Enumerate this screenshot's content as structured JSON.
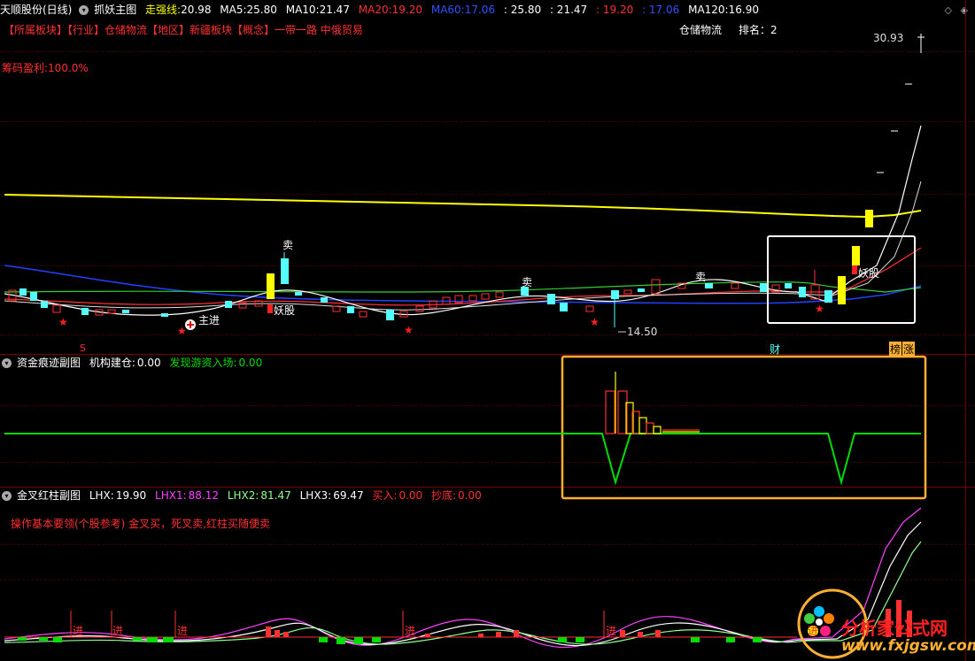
{
  "header": {
    "stock_name": "天顺股份(日线)",
    "indicator_name": "抓妖主图",
    "strong_line_label": "走强线:",
    "strong_line_value": "20.98",
    "ma5_label": "MA5:",
    "ma5_value": "25.80",
    "ma10_label": "MA10:",
    "ma10_value": "21.47",
    "ma20_label": "MA20:",
    "ma20_value": "19.20",
    "ma60_label": "MA60:",
    "ma60_value": "17.06",
    "extra1": ": 25.80",
    "extra2": ": 21.47",
    "extra3": ": 19.20",
    "extra4": ": 17.06",
    "ma120_label": "MA120:",
    "ma120_value": "16.90"
  },
  "sectors": {
    "line": "【所属板块】【行业】仓储物流【地区】新疆板块【概念】一带一路 中俄贸易",
    "industry_name": "仓储物流",
    "rank_label": "排名：",
    "rank_value": "2"
  },
  "main_chart": {
    "chip_profit": "筹码盈利:100.0%",
    "high_price": "30.93",
    "low_price": "14.50",
    "sell_labels": [
      "卖",
      "卖",
      "卖"
    ],
    "demon_labels": [
      "妖股",
      "妖股"
    ],
    "entry_label": "主进",
    "marker_cai": "财",
    "marker_bang": "榜",
    "marker_zhang": "涨",
    "marker_s": "S"
  },
  "sub1": {
    "title": "资金痕迹副图",
    "inst_label": "机构建仓:",
    "inst_value": "0.00",
    "hot_label": "发现游资入场:",
    "hot_value": "0.00"
  },
  "sub2": {
    "title": "金叉红柱副图",
    "lhx_label": "LHX:",
    "lhx_value": "19.90",
    "lhx1_label": "LHX1:",
    "lhx1_value": "88.12",
    "lhx2_label": "LHX2:",
    "lhx2_value": "81.47",
    "lhx3_label": "LHX3:",
    "lhx3_value": "69.47",
    "buy_label": "买入:",
    "buy_value": "0.00",
    "bottom_label": "抄底:",
    "bottom_value": "0.00",
    "note": "操作基本要领(个股参考) 金叉买，死叉卖,红柱买随便卖",
    "jin_labels": [
      "进",
      "进",
      "进",
      "进",
      "进",
      "进"
    ]
  },
  "watermark": {
    "brand": "分析家公式网",
    "url": "www.fxjgsw.com"
  },
  "colors": {
    "yellow": "#ffff00",
    "red": "#ff3030",
    "cyan": "#54ffff",
    "green": "#00dd00",
    "blue": "#2040ff",
    "magenta": "#ff40ff",
    "white": "#ffffff",
    "orange": "#ffb030"
  }
}
